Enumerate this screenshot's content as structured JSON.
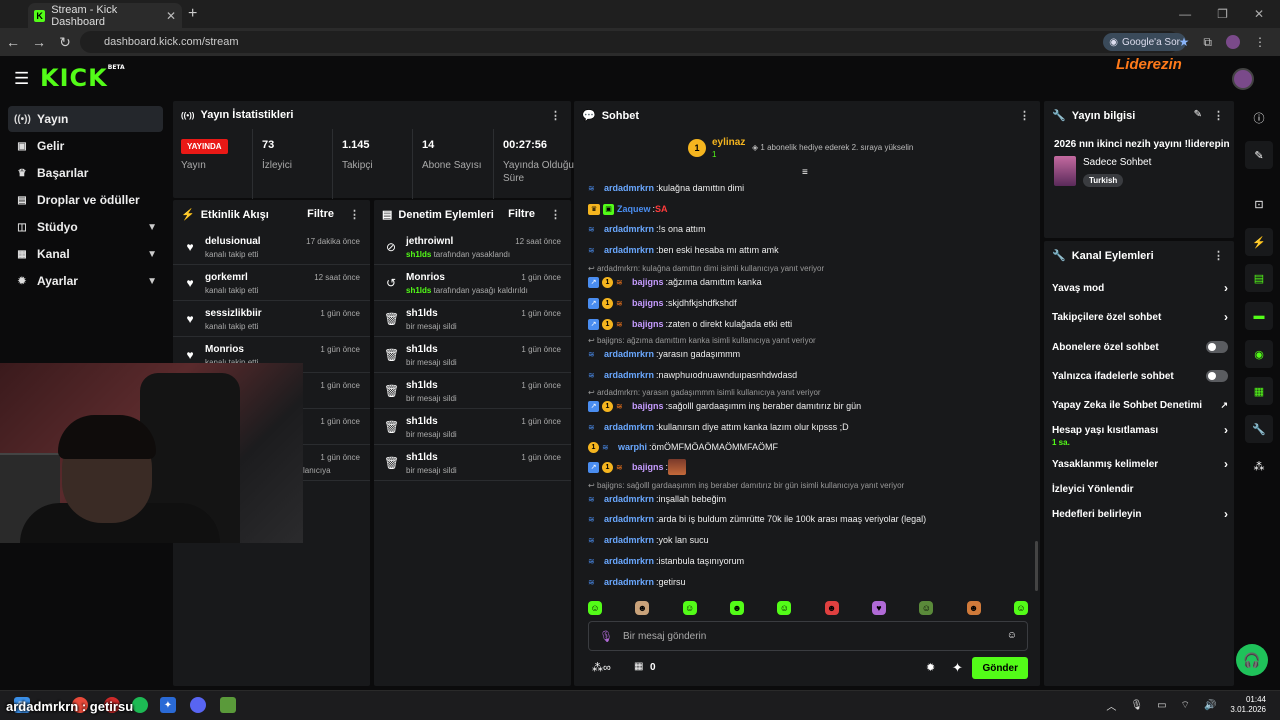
{
  "browser": {
    "tab_title": "Stream - Kick Dashboard",
    "url": "dashboard.kick.com/stream",
    "google_sor": "Google'a Sor"
  },
  "header": {
    "logo": "KICK",
    "logo_beta": "BETA",
    "partner_logo": "Liderezin"
  },
  "sidebar": {
    "items": [
      {
        "label": "Yayın",
        "icon": "broadcast-icon",
        "active": true
      },
      {
        "label": "Gelir",
        "icon": "revenue-icon"
      },
      {
        "label": "Başarılar",
        "icon": "trophy-icon"
      },
      {
        "label": "Droplar ve ödüller",
        "icon": "gift-icon"
      },
      {
        "label": "Stüdyo",
        "icon": "studio-icon",
        "expandable": true
      },
      {
        "label": "Kanal",
        "icon": "channel-icon",
        "expandable": true
      },
      {
        "label": "Ayarlar",
        "icon": "gear-icon",
        "expandable": true
      }
    ]
  },
  "stats": {
    "title": "Yayın İstatistikleri",
    "live_badge": "YAYINDA",
    "live_label": "Yayın",
    "viewers_value": "73",
    "viewers_label": "İzleyici",
    "followers_value": "1.145",
    "followers_label": "Takipçi",
    "subs_value": "14",
    "subs_label": "Abone Sayısı",
    "duration_value": "00:27:56",
    "duration_label": "Yayında Olduğu Süre"
  },
  "activity": {
    "title": "Etkinlik Akışı",
    "filter": "Filtre",
    "rows": [
      {
        "name": "delusionual",
        "desc": "kanalı takip etti",
        "time": "17 dakika önce"
      },
      {
        "name": "gorkemrl",
        "desc": "kanalı takip etti",
        "time": "12 saat önce"
      },
      {
        "name": "sessizlikbiir",
        "desc": "kanalı takip etti",
        "time": "1 gün önce"
      },
      {
        "name": "Monrios",
        "desc": "kanalı takip etti",
        "time": "1 gün önce"
      },
      {
        "name": "",
        "desc": "",
        "time": "1 gün önce"
      },
      {
        "name": "",
        "desc": "",
        "time": "1 gün önce"
      },
      {
        "name": "",
        "desc": "lanıcıya",
        "time": "1 gün önce"
      }
    ]
  },
  "moderation": {
    "title": "Denetim Eylemleri",
    "filter": "Filtre",
    "rows": [
      {
        "name": "jethroiwnl",
        "actor": "sh1lds",
        "desc": "tarafından yasaklandı",
        "time": "12 saat önce",
        "icon": "ban-icon"
      },
      {
        "name": "Monrios",
        "actor": "sh1lds",
        "desc": "tarafından yasağı kaldırıldı",
        "time": "1 gün önce",
        "icon": "undo-icon"
      },
      {
        "name": "sh1lds",
        "actor": "",
        "desc": "bir mesajı sildi",
        "time": "1 gün önce",
        "icon": "trash-icon"
      },
      {
        "name": "sh1lds",
        "actor": "",
        "desc": "bir mesajı sildi",
        "time": "1 gün önce",
        "icon": "trash-icon"
      },
      {
        "name": "sh1lds",
        "actor": "",
        "desc": "bir mesajı sildi",
        "time": "1 gün önce",
        "icon": "trash-icon"
      },
      {
        "name": "sh1lds",
        "actor": "",
        "desc": "bir mesajı sildi",
        "time": "1 gün önce",
        "icon": "trash-icon"
      },
      {
        "name": "sh1lds",
        "actor": "",
        "desc": "bir mesajı sildi",
        "time": "1 gün önce",
        "icon": "trash-icon"
      }
    ]
  },
  "chat": {
    "title": "Sohbet",
    "pinned_user": "eylinaz",
    "pinned_count": "1",
    "gift_text": "1 abonelik hediye ederek 2. sıraya yükselin",
    "messages": [
      {
        "type": "msg",
        "user": "ardadmrkrn",
        "color": "#6aa8ff",
        "text": "kulağna damıttın dimi",
        "badges": [
          "icon"
        ]
      },
      {
        "type": "msg",
        "user": "Zaquew",
        "color": "#4a8df0",
        "text": "SA",
        "text_color": "#ff3b3b",
        "badges": [
          "crown",
          "gift"
        ]
      },
      {
        "type": "msg",
        "user": "ardadmrkrn",
        "color": "#6aa8ff",
        "text": "!s ona attım",
        "badges": [
          "icon"
        ]
      },
      {
        "type": "msg",
        "user": "ardadmrkrn",
        "color": "#6aa8ff",
        "text": "ben eski hesaba mı attım amk",
        "badges": [
          "icon"
        ]
      },
      {
        "type": "reply",
        "text": "ardadmrkrn: kulağna damıttın dimi isimli kullanıcıya yanıt veriyor"
      },
      {
        "type": "msg",
        "user": "bajigns",
        "color": "#c69cff",
        "text": "ağzıma damıttım kanka",
        "badges": [
          "sq",
          "sub",
          "icon"
        ]
      },
      {
        "type": "msg",
        "user": "bajigns",
        "color": "#c69cff",
        "text": "skjdhfkjshdfkshdf",
        "badges": [
          "sq",
          "sub",
          "icon"
        ]
      },
      {
        "type": "msg",
        "user": "bajigns",
        "color": "#c69cff",
        "text": "zaten o direkt kulağada etki etti",
        "badges": [
          "sq",
          "sub",
          "icon"
        ]
      },
      {
        "type": "reply",
        "text": "bajigns: ağzıma damıttım kanka isimli kullanıcıya yanıt veriyor"
      },
      {
        "type": "msg",
        "user": "ardadmrkrn",
        "color": "#6aa8ff",
        "text": "yarasın gadaşımmm",
        "badges": [
          "icon"
        ]
      },
      {
        "type": "msg",
        "user": "ardadmrkrn",
        "color": "#6aa8ff",
        "text": "nawphuıodnuawnduıpasnhdwdasd",
        "badges": [
          "icon"
        ]
      },
      {
        "type": "reply",
        "text": "ardadmrkrn: yarasın gadaşımmm isimli kullanıcıya yanıt veriyor"
      },
      {
        "type": "msg",
        "user": "bajigns",
        "color": "#c69cff",
        "text": "sağolll gardaaşımm inş beraber damıtırız bir gün",
        "badges": [
          "sq",
          "sub",
          "icon"
        ]
      },
      {
        "type": "msg",
        "user": "ardadmrkrn",
        "color": "#6aa8ff",
        "text": "kullanırsın diye attım kanka lazım olur kıpsss ;D",
        "badges": [
          "icon"
        ]
      },
      {
        "type": "msg",
        "user": "warphi",
        "color": "#6aa8ff",
        "text": "ömÖMFMÖAÖMAÖMMFAÖMF",
        "badges": [
          "sub",
          "icon"
        ]
      },
      {
        "type": "msg",
        "user": "bajigns",
        "color": "#c69cff",
        "text": "",
        "badges": [
          "sq",
          "sub",
          "icon"
        ],
        "emote": true
      },
      {
        "type": "reply",
        "text": "bajigns: sağolll gardaaşımm inş beraber damıtırız bir gün isimli kullanıcıya yanıt veriyor"
      },
      {
        "type": "msg",
        "user": "ardadmrkrn",
        "color": "#6aa8ff",
        "text": "inşallah bebeğim",
        "badges": [
          "icon"
        ]
      },
      {
        "type": "msg",
        "user": "ardadmrkrn",
        "color": "#6aa8ff",
        "text": "arda bi iş buldum zümrütte 70k ile 100k arası maaş veriyolar (legal)",
        "badges": [
          "icon"
        ]
      },
      {
        "type": "msg",
        "user": "ardadmrkrn",
        "color": "#6aa8ff",
        "text": "yok lan sucu",
        "badges": [
          "icon"
        ]
      },
      {
        "type": "msg",
        "user": "ardadmrkrn",
        "color": "#6aa8ff",
        "text": "istanbula taşınıyorum",
        "badges": [
          "icon"
        ]
      },
      {
        "type": "msg",
        "user": "ardadmrkrn",
        "color": "#6aa8ff",
        "text": "getirsu",
        "badges": [
          "icon"
        ]
      }
    ],
    "input_placeholder": "Bir mesaj gönderin",
    "points": "0",
    "send_label": "Gönder"
  },
  "stream_info": {
    "title": "Yayın bilgisi",
    "stream_title": "2026 nın ikinci nezih yayını !liderepin",
    "category": "Sadece Sohbet",
    "tag": "Turkish"
  },
  "channel_actions": {
    "title": "Kanal Eylemleri",
    "items": [
      {
        "label": "Yavaş mod",
        "control": "chevron"
      },
      {
        "label": "Takipçilere özel sohbet",
        "control": "chevron"
      },
      {
        "label": "Abonelere özel sohbet",
        "control": "toggle",
        "on": false
      },
      {
        "label": "Yalnızca ifadelerle sohbet",
        "control": "toggle",
        "on": false
      },
      {
        "label": "Yapay Zeka ile Sohbet Denetimi",
        "control": "external"
      },
      {
        "label": "Hesap yaşı kısıtlaması",
        "sub": "1 sa.",
        "control": "chevron"
      },
      {
        "label": "Yasaklanmış kelimeler",
        "control": "chevron"
      },
      {
        "label": "İzleyici Yönlendir",
        "control": "none"
      },
      {
        "label": "Hedefleri belirleyin",
        "control": "chevron"
      }
    ]
  },
  "overlay_text": "ardadmrkrn : getirsu",
  "clock": {
    "time": "01:44",
    "date": "3.01.2026"
  },
  "colors": {
    "accent": "#53fc18",
    "live": "#e91916",
    "panel": "#18191b",
    "bg": "#0b0b0c"
  }
}
